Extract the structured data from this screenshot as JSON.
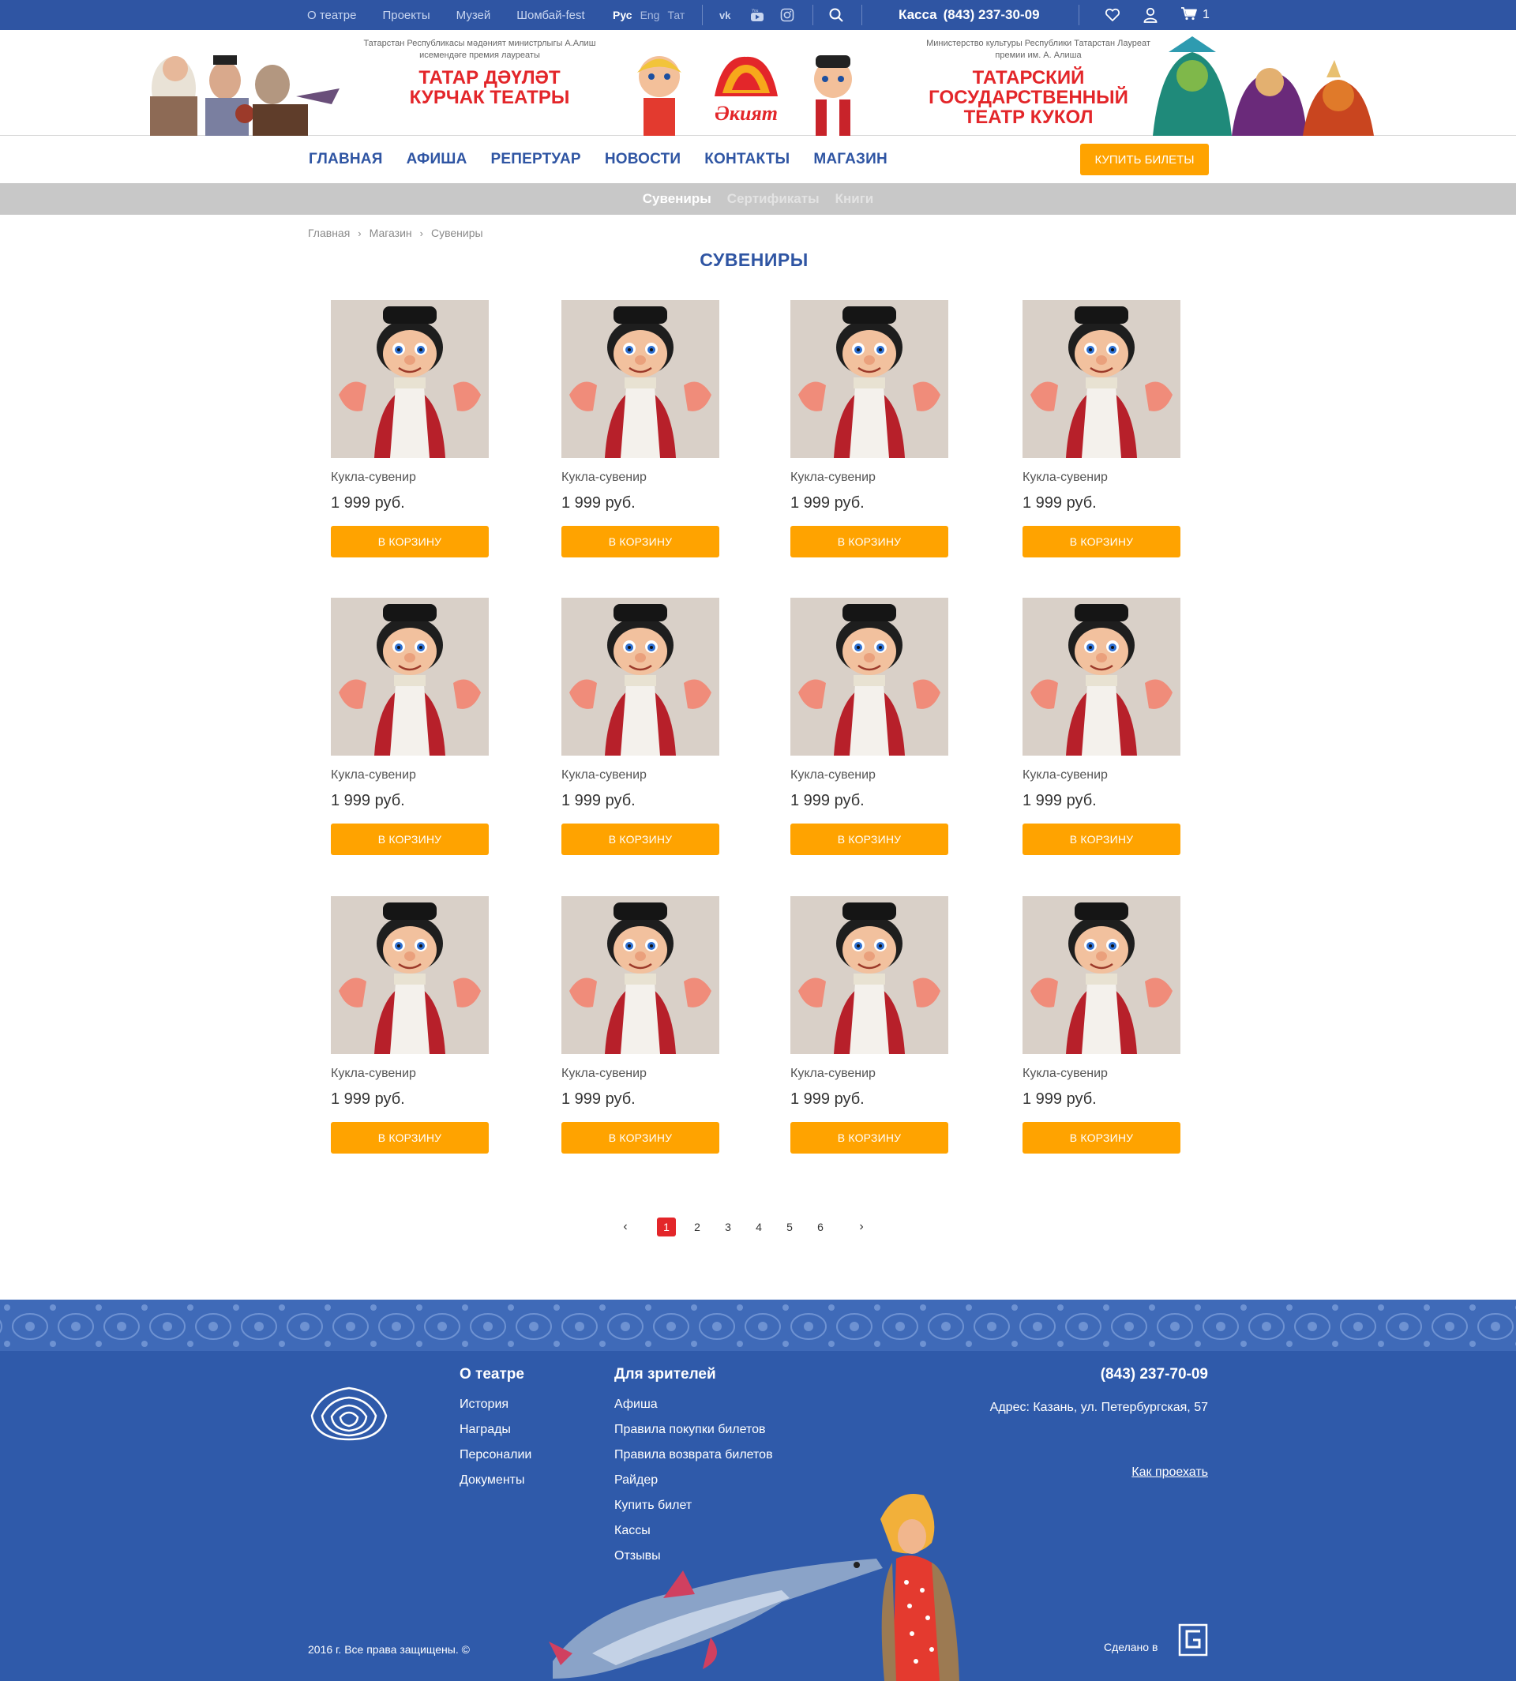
{
  "topbar": {
    "links": [
      "О театре",
      "Проекты",
      "Музей",
      "Шомбай-fest"
    ],
    "languages": [
      {
        "label": "Рус",
        "active": true
      },
      {
        "label": "Eng",
        "active": false
      },
      {
        "label": "Тат",
        "active": false
      }
    ],
    "social_icons": [
      "vk-icon",
      "youtube-icon",
      "instagram-icon"
    ],
    "kassa_label": "Касса",
    "kassa_phone": "(843) 237-30-09",
    "cart_count": "1"
  },
  "banner": {
    "ministry_left": "Татарстан Республикасы мәдәният министрлыгы А.Алиш исемендәге премия лауреаты",
    "title_left": "ТАТАР ДӘҮЛӘТ КУРЧАК ТЕАТРЫ",
    "logo_text": "Әкият",
    "ministry_right": "Министерство культуры Республики Татарстан Лауреат премии им. А. Алиша",
    "title_right": "ТАТАРСКИЙ ГОСУДАРСТВЕННЫЙ ТЕАТР КУКОЛ"
  },
  "nav": {
    "items": [
      "ГЛАВНАЯ",
      "АФИША",
      "РЕПЕРТУАР",
      "НОВОСТИ",
      "КОНТАКТЫ",
      "МАГАЗИН"
    ],
    "buy_tickets": "КУПИТЬ БИЛЕТЫ"
  },
  "subnav": {
    "items": [
      {
        "label": "Сувениры",
        "active": true
      },
      {
        "label": "Сертификаты",
        "active": false
      },
      {
        "label": "Книги",
        "active": false
      }
    ]
  },
  "breadcrumb": [
    "Главная",
    "Магазин",
    "Сувениры"
  ],
  "page_title": "СУВЕНИРЫ",
  "products": [
    {
      "name": "Кукла-сувенир",
      "price": "1 999 руб.",
      "button": "В КОРЗИНУ"
    },
    {
      "name": "Кукла-сувенир",
      "price": "1 999 руб.",
      "button": "В КОРЗИНУ"
    },
    {
      "name": "Кукла-сувенир",
      "price": "1 999 руб.",
      "button": "В КОРЗИНУ"
    },
    {
      "name": "Кукла-сувенир",
      "price": "1 999 руб.",
      "button": "В КОРЗИНУ"
    },
    {
      "name": "Кукла-сувенир",
      "price": "1 999 руб.",
      "button": "В КОРЗИНУ"
    },
    {
      "name": "Кукла-сувенир",
      "price": "1 999 руб.",
      "button": "В КОРЗИНУ"
    },
    {
      "name": "Кукла-сувенир",
      "price": "1 999 руб.",
      "button": "В КОРЗИНУ"
    },
    {
      "name": "Кукла-сувенир",
      "price": "1 999 руб.",
      "button": "В КОРЗИНУ"
    },
    {
      "name": "Кукла-сувенир",
      "price": "1 999 руб.",
      "button": "В КОРЗИНУ"
    },
    {
      "name": "Кукла-сувенир",
      "price": "1 999 руб.",
      "button": "В КОРЗИНУ"
    },
    {
      "name": "Кукла-сувенир",
      "price": "1 999 руб.",
      "button": "В КОРЗИНУ"
    },
    {
      "name": "Кукла-сувенир",
      "price": "1 999 руб.",
      "button": "В КОРЗИНУ"
    }
  ],
  "pagination": {
    "pages": [
      "1",
      "2",
      "3",
      "4",
      "5",
      "6"
    ],
    "current": "1"
  },
  "footer": {
    "col1_title": "О театре",
    "col1_links": [
      "История",
      "Награды",
      "Персоналии",
      "Документы"
    ],
    "col2_title": "Для зрителей",
    "col2_links": [
      "Афиша",
      "Правила покупки билетов",
      "Правила возврата билетов",
      "Райдер",
      "Купить билет",
      "Кассы",
      "Отзывы"
    ],
    "phone": "(843) 237-70-09",
    "address": "Адрес: Казань, ул. Петербургская, 57",
    "route_link": "Как проехать",
    "copyright": "2016 г. Все права защищены. ©",
    "made_in": "Сделано в"
  },
  "colors": {
    "brand_blue": "#2f55a3",
    "accent_orange": "#ffa300",
    "accent_red": "#e3262a",
    "subnav_gray": "#c8c8c8"
  }
}
